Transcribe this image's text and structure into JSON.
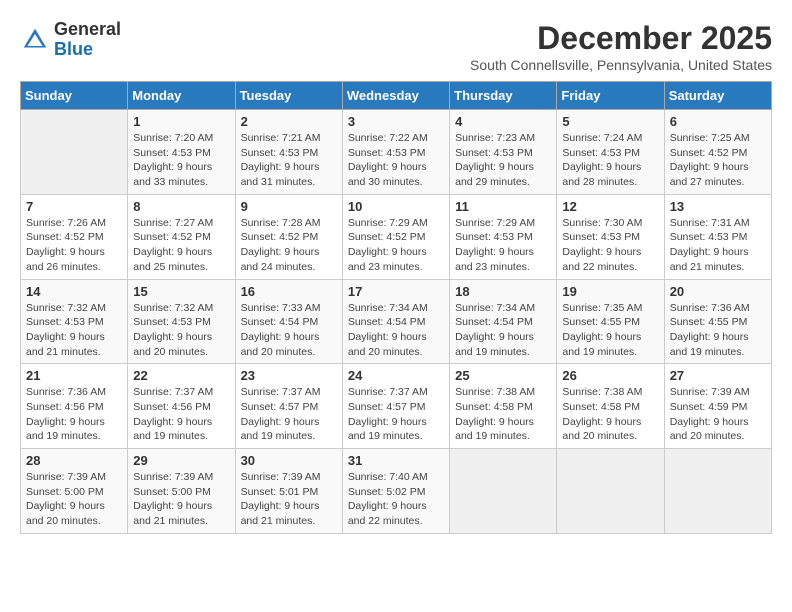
{
  "header": {
    "logo_general": "General",
    "logo_blue": "Blue",
    "month_title": "December 2025",
    "location": "South Connellsville, Pennsylvania, United States"
  },
  "days_of_week": [
    "Sunday",
    "Monday",
    "Tuesday",
    "Wednesday",
    "Thursday",
    "Friday",
    "Saturday"
  ],
  "weeks": [
    [
      {
        "day": "",
        "info": ""
      },
      {
        "day": "1",
        "info": "Sunrise: 7:20 AM\nSunset: 4:53 PM\nDaylight: 9 hours\nand 33 minutes."
      },
      {
        "day": "2",
        "info": "Sunrise: 7:21 AM\nSunset: 4:53 PM\nDaylight: 9 hours\nand 31 minutes."
      },
      {
        "day": "3",
        "info": "Sunrise: 7:22 AM\nSunset: 4:53 PM\nDaylight: 9 hours\nand 30 minutes."
      },
      {
        "day": "4",
        "info": "Sunrise: 7:23 AM\nSunset: 4:53 PM\nDaylight: 9 hours\nand 29 minutes."
      },
      {
        "day": "5",
        "info": "Sunrise: 7:24 AM\nSunset: 4:53 PM\nDaylight: 9 hours\nand 28 minutes."
      },
      {
        "day": "6",
        "info": "Sunrise: 7:25 AM\nSunset: 4:52 PM\nDaylight: 9 hours\nand 27 minutes."
      }
    ],
    [
      {
        "day": "7",
        "info": "Sunrise: 7:26 AM\nSunset: 4:52 PM\nDaylight: 9 hours\nand 26 minutes."
      },
      {
        "day": "8",
        "info": "Sunrise: 7:27 AM\nSunset: 4:52 PM\nDaylight: 9 hours\nand 25 minutes."
      },
      {
        "day": "9",
        "info": "Sunrise: 7:28 AM\nSunset: 4:52 PM\nDaylight: 9 hours\nand 24 minutes."
      },
      {
        "day": "10",
        "info": "Sunrise: 7:29 AM\nSunset: 4:52 PM\nDaylight: 9 hours\nand 23 minutes."
      },
      {
        "day": "11",
        "info": "Sunrise: 7:29 AM\nSunset: 4:53 PM\nDaylight: 9 hours\nand 23 minutes."
      },
      {
        "day": "12",
        "info": "Sunrise: 7:30 AM\nSunset: 4:53 PM\nDaylight: 9 hours\nand 22 minutes."
      },
      {
        "day": "13",
        "info": "Sunrise: 7:31 AM\nSunset: 4:53 PM\nDaylight: 9 hours\nand 21 minutes."
      }
    ],
    [
      {
        "day": "14",
        "info": "Sunrise: 7:32 AM\nSunset: 4:53 PM\nDaylight: 9 hours\nand 21 minutes."
      },
      {
        "day": "15",
        "info": "Sunrise: 7:32 AM\nSunset: 4:53 PM\nDaylight: 9 hours\nand 20 minutes."
      },
      {
        "day": "16",
        "info": "Sunrise: 7:33 AM\nSunset: 4:54 PM\nDaylight: 9 hours\nand 20 minutes."
      },
      {
        "day": "17",
        "info": "Sunrise: 7:34 AM\nSunset: 4:54 PM\nDaylight: 9 hours\nand 20 minutes."
      },
      {
        "day": "18",
        "info": "Sunrise: 7:34 AM\nSunset: 4:54 PM\nDaylight: 9 hours\nand 19 minutes."
      },
      {
        "day": "19",
        "info": "Sunrise: 7:35 AM\nSunset: 4:55 PM\nDaylight: 9 hours\nand 19 minutes."
      },
      {
        "day": "20",
        "info": "Sunrise: 7:36 AM\nSunset: 4:55 PM\nDaylight: 9 hours\nand 19 minutes."
      }
    ],
    [
      {
        "day": "21",
        "info": "Sunrise: 7:36 AM\nSunset: 4:56 PM\nDaylight: 9 hours\nand 19 minutes."
      },
      {
        "day": "22",
        "info": "Sunrise: 7:37 AM\nSunset: 4:56 PM\nDaylight: 9 hours\nand 19 minutes."
      },
      {
        "day": "23",
        "info": "Sunrise: 7:37 AM\nSunset: 4:57 PM\nDaylight: 9 hours\nand 19 minutes."
      },
      {
        "day": "24",
        "info": "Sunrise: 7:37 AM\nSunset: 4:57 PM\nDaylight: 9 hours\nand 19 minutes."
      },
      {
        "day": "25",
        "info": "Sunrise: 7:38 AM\nSunset: 4:58 PM\nDaylight: 9 hours\nand 19 minutes."
      },
      {
        "day": "26",
        "info": "Sunrise: 7:38 AM\nSunset: 4:58 PM\nDaylight: 9 hours\nand 20 minutes."
      },
      {
        "day": "27",
        "info": "Sunrise: 7:39 AM\nSunset: 4:59 PM\nDaylight: 9 hours\nand 20 minutes."
      }
    ],
    [
      {
        "day": "28",
        "info": "Sunrise: 7:39 AM\nSunset: 5:00 PM\nDaylight: 9 hours\nand 20 minutes."
      },
      {
        "day": "29",
        "info": "Sunrise: 7:39 AM\nSunset: 5:00 PM\nDaylight: 9 hours\nand 21 minutes."
      },
      {
        "day": "30",
        "info": "Sunrise: 7:39 AM\nSunset: 5:01 PM\nDaylight: 9 hours\nand 21 minutes."
      },
      {
        "day": "31",
        "info": "Sunrise: 7:40 AM\nSunset: 5:02 PM\nDaylight: 9 hours\nand 22 minutes."
      },
      {
        "day": "",
        "info": ""
      },
      {
        "day": "",
        "info": ""
      },
      {
        "day": "",
        "info": ""
      }
    ]
  ]
}
